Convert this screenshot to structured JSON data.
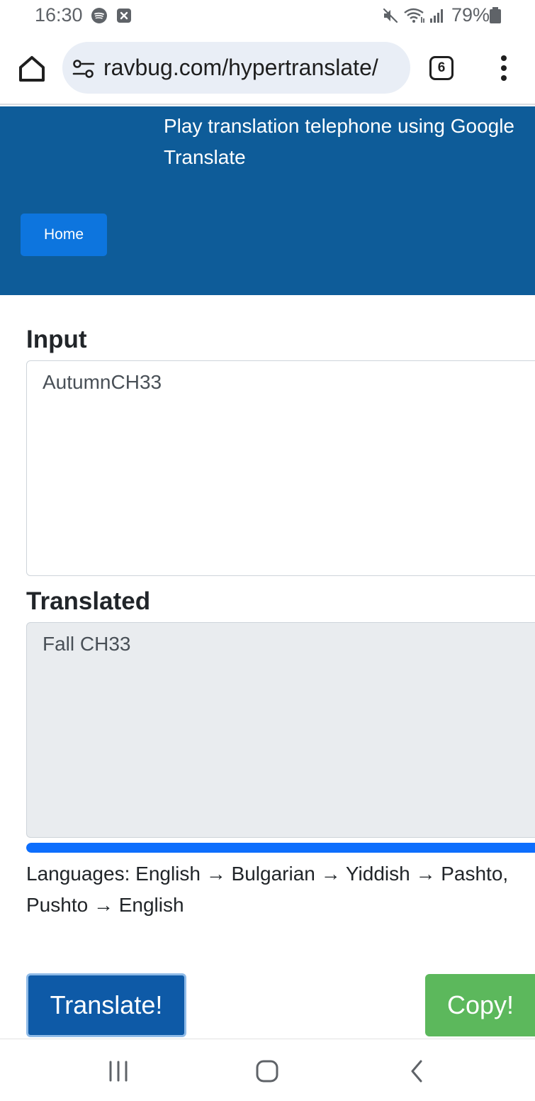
{
  "status_bar": {
    "time": "16:30",
    "notification_icons": [
      "spotify-icon",
      "close-notification-icon"
    ],
    "system_icons": [
      "mute-icon",
      "wifi-icon",
      "signal-icon",
      "battery-icon"
    ],
    "battery_percent": "79%"
  },
  "browser": {
    "url": "ravbug.com/hypertranslate/",
    "tab_count": "6"
  },
  "header": {
    "tagline": "Play translation telephone using Google Translate",
    "home_label": "Home",
    "background_color": "#0e5c99"
  },
  "main": {
    "input_label": "Input",
    "input_value": "AutumnCH33",
    "translated_label": "Translated",
    "translated_value": "Fall CH33",
    "progress_fraction": 1.0,
    "languages_text": "Languages: English → Bulgarian → Yiddish → Pashto, Pushto → English",
    "translate_label": "Translate!",
    "copy_label": "Copy!"
  },
  "colors": {
    "accent": "#0d6efd",
    "translate_button": "#0e5aa7",
    "copy_button": "#5cb85c"
  },
  "nav_bar": {
    "icons": [
      "recent-apps-icon",
      "home-icon",
      "back-icon"
    ]
  }
}
